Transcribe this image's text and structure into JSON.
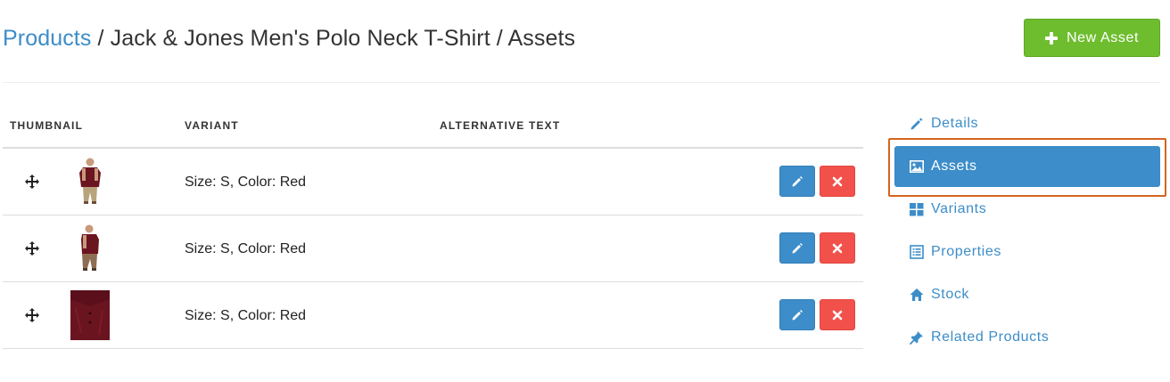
{
  "breadcrumb": {
    "root": "Products",
    "sep1": " / ",
    "product": "Jack & Jones Men's Polo Neck T-Shirt",
    "sep2": " / ",
    "current": "Assets"
  },
  "actions": {
    "new_asset": "New Asset",
    "new_asset_icon": "plus-icon"
  },
  "table": {
    "columns": [
      "THUMBNAIL",
      "VARIANT",
      "ALTERNATIVE TEXT"
    ],
    "rows": [
      {
        "variant": "Size: S, Color: Red",
        "alt_text": "",
        "thumbnail": "polo-shirt-front"
      },
      {
        "variant": "Size: S, Color: Red",
        "alt_text": "",
        "thumbnail": "polo-shirt-side"
      },
      {
        "variant": "Size: S, Color: Red",
        "alt_text": "",
        "thumbnail": "polo-shirt-fabric-closeup"
      }
    ]
  },
  "side_menu": {
    "items": [
      {
        "label": "Details",
        "icon": "pencil-icon",
        "active": false
      },
      {
        "label": "Assets",
        "icon": "image-icon",
        "active": true
      },
      {
        "label": "Variants",
        "icon": "grid-icon",
        "active": false
      },
      {
        "label": "Properties",
        "icon": "list-icon",
        "active": false
      },
      {
        "label": "Stock",
        "icon": "home-icon",
        "active": false
      },
      {
        "label": "Related Products",
        "icon": "pin-icon",
        "active": false
      }
    ]
  },
  "colors": {
    "link_blue": "#3c8dc9",
    "success_green": "#6ebd2f",
    "danger_red": "#f2514b",
    "highlight_orange": "#d4641f"
  }
}
